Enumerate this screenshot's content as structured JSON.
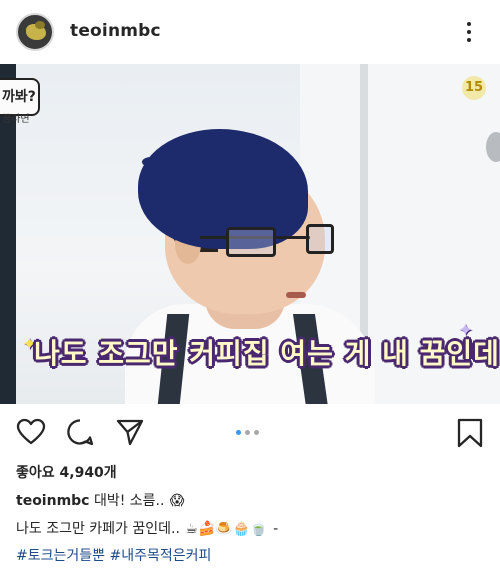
{
  "header": {
    "username": "teoinmbc",
    "more_icon": "more-vertical-icon"
  },
  "photo": {
    "sign_text": "까봐?",
    "sign_sub": "꿈라면",
    "episode_badge": "15",
    "caption_text": "나도 조그만 커피집 여는 게 내 꿈인데"
  },
  "actions": {
    "like_icon": "heart-icon",
    "comment_icon": "comment-icon",
    "share_icon": "send-icon",
    "save_icon": "bookmark-icon"
  },
  "likes": "좋아요 4,940개",
  "caption": {
    "username": "teoinmbc",
    "line1": "대박! 소름..",
    "line1_emoji": "😱",
    "line2": "나도 조그만 카페가 꿈인데..",
    "line2_emojis": "☕🍰🍮🧁🍵",
    "line2_tail": "-",
    "hashtags": [
      "#토크는거들뿐",
      "#내주목적은커피"
    ]
  }
}
